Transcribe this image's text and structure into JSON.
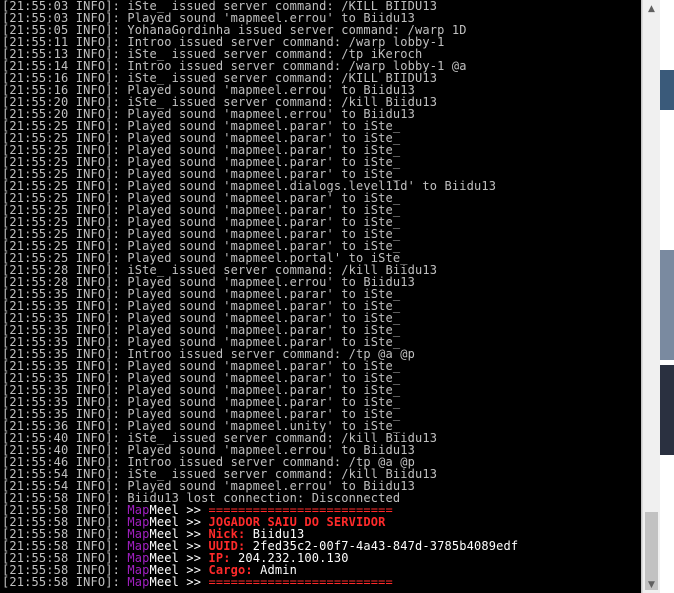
{
  "colors": {
    "text": "#c0c0c0",
    "map": "#a020c0",
    "meel": "#ffffff",
    "prompt": "#ffffff",
    "separator": "#ff2a2a",
    "label": "#ff2a2a",
    "value": "#ffffff",
    "title": "#ff2a2a"
  },
  "scrollbar": {
    "up_icon": "triangle-up",
    "down_icon": "triangle-down"
  },
  "console": {
    "lines": [
      [
        {
          "t": "[21:55:03 INFO]: iSte_ issued server command: /KILL BIIDU13"
        }
      ],
      [
        {
          "t": "[21:55:03 INFO]: Played sound 'mapmeel.errou' to Biidu13"
        }
      ],
      [
        {
          "t": "[21:55:05 INFO]: YohanaGordinha issued server command: /warp 1D"
        }
      ],
      [
        {
          "t": "[21:55:11 INFO]: Introo issued server command: /warp lobby-1"
        }
      ],
      [
        {
          "t": "[21:55:13 INFO]: iSte_ issued server command: /tp iKeroch"
        }
      ],
      [
        {
          "t": "[21:55:14 INFO]: Introo issued server command: /warp lobby-1 @a"
        }
      ],
      [
        {
          "t": "[21:55:16 INFO]: iSte_ issued server command: /KILL BIIDU13"
        }
      ],
      [
        {
          "t": "[21:55:16 INFO]: Played sound 'mapmeel.errou' to Biidu13"
        }
      ],
      [
        {
          "t": "[21:55:20 INFO]: iSte_ issued server command: /kill Biidu13"
        }
      ],
      [
        {
          "t": "[21:55:20 INFO]: Played sound 'mapmeel.errou' to Biidu13"
        }
      ],
      [
        {
          "t": "[21:55:25 INFO]: Played sound 'mapmeel.parar' to iSte_"
        }
      ],
      [
        {
          "t": "[21:55:25 INFO]: Played sound 'mapmeel.parar' to iSte_"
        }
      ],
      [
        {
          "t": "[21:55:25 INFO]: Played sound 'mapmeel.parar' to iSte_"
        }
      ],
      [
        {
          "t": "[21:55:25 INFO]: Played sound 'mapmeel.parar' to iSte_"
        }
      ],
      [
        {
          "t": "[21:55:25 INFO]: Played sound 'mapmeel.parar' to iSte_"
        }
      ],
      [
        {
          "t": "[21:55:25 INFO]: Played sound 'mapmeel.dialogs.level11d' to Biidu13"
        }
      ],
      [
        {
          "t": "[21:55:25 INFO]: Played sound 'mapmeel.parar' to iSte_"
        }
      ],
      [
        {
          "t": "[21:55:25 INFO]: Played sound 'mapmeel.parar' to iSte_"
        }
      ],
      [
        {
          "t": "[21:55:25 INFO]: Played sound 'mapmeel.parar' to iSte_"
        }
      ],
      [
        {
          "t": "[21:55:25 INFO]: Played sound 'mapmeel.parar' to iSte_"
        }
      ],
      [
        {
          "t": "[21:55:25 INFO]: Played sound 'mapmeel.parar' to iSte_"
        }
      ],
      [
        {
          "t": "[21:55:25 INFO]: Played sound 'mapmeel.portal' to iSte_"
        }
      ],
      [
        {
          "t": "[21:55:28 INFO]: iSte_ issued server command: /kill Biidu13"
        }
      ],
      [
        {
          "t": "[21:55:28 INFO]: Played sound 'mapmeel.errou' to Biidu13"
        }
      ],
      [
        {
          "t": "[21:55:35 INFO]: Played sound 'mapmeel.parar' to iSte_"
        }
      ],
      [
        {
          "t": "[21:55:35 INFO]: Played sound 'mapmeel.parar' to iSte_"
        }
      ],
      [
        {
          "t": "[21:55:35 INFO]: Played sound 'mapmeel.parar' to iSte_"
        }
      ],
      [
        {
          "t": "[21:55:35 INFO]: Played sound 'mapmeel.parar' to iSte_"
        }
      ],
      [
        {
          "t": "[21:55:35 INFO]: Played sound 'mapmeel.parar' to iSte_"
        }
      ],
      [
        {
          "t": "[21:55:35 INFO]: Introo issued server command: /tp @a @p"
        }
      ],
      [
        {
          "t": "[21:55:35 INFO]: Played sound 'mapmeel.parar' to iSte_"
        }
      ],
      [
        {
          "t": "[21:55:35 INFO]: Played sound 'mapmeel.parar' to iSte_"
        }
      ],
      [
        {
          "t": "[21:55:35 INFO]: Played sound 'mapmeel.parar' to iSte_"
        }
      ],
      [
        {
          "t": "[21:55:35 INFO]: Played sound 'mapmeel.parar' to iSte_"
        }
      ],
      [
        {
          "t": "[21:55:35 INFO]: Played sound 'mapmeel.parar' to iSte_"
        }
      ],
      [
        {
          "t": "[21:55:36 INFO]: Played sound 'mapmeel.unity' to iSte_"
        }
      ],
      [
        {
          "t": "[21:55:40 INFO]: iSte_ issued server command: /kill Biidu13"
        }
      ],
      [
        {
          "t": "[21:55:40 INFO]: Played sound 'mapmeel.errou' to Biidu13"
        }
      ],
      [
        {
          "t": "[21:55:46 INFO]: Introo issued server command: /tp @a @p"
        }
      ],
      [
        {
          "t": "[21:55:54 INFO]: iSte_ issued server command: /kill Biidu13"
        }
      ],
      [
        {
          "t": "[21:55:54 INFO]: Played sound 'mapmeel.errou' to Biidu13"
        }
      ],
      [
        {
          "t": "[21:55:58 INFO]: Biidu13 lost connection: Disconnected"
        }
      ],
      [
        {
          "t": "[21:55:58 INFO]: "
        },
        {
          "t": "Map",
          "c": "map"
        },
        {
          "t": "Meel",
          "c": "meel"
        },
        {
          "t": " >> ",
          "c": "prompt"
        },
        {
          "t": "=========================",
          "c": "separator"
        }
      ],
      [
        {
          "t": "[21:55:58 INFO]: "
        },
        {
          "t": "Map",
          "c": "map"
        },
        {
          "t": "Meel",
          "c": "meel"
        },
        {
          "t": " >> ",
          "c": "prompt"
        },
        {
          "t": "JOGADOR SAIU DO SERVIDOR",
          "c": "title"
        }
      ],
      [
        {
          "t": "[21:55:58 INFO]: "
        },
        {
          "t": "Map",
          "c": "map"
        },
        {
          "t": "Meel",
          "c": "meel"
        },
        {
          "t": " >> ",
          "c": "prompt"
        },
        {
          "t": "Nick: ",
          "c": "label"
        },
        {
          "t": "Biidu13",
          "c": "value"
        }
      ],
      [
        {
          "t": "[21:55:58 INFO]: "
        },
        {
          "t": "Map",
          "c": "map"
        },
        {
          "t": "Meel",
          "c": "meel"
        },
        {
          "t": " >> ",
          "c": "prompt"
        },
        {
          "t": "UUID: ",
          "c": "label"
        },
        {
          "t": "2fed35c2-00f7-4a43-847d-3785b4089edf",
          "c": "value"
        }
      ],
      [
        {
          "t": "[21:55:58 INFO]: "
        },
        {
          "t": "Map",
          "c": "map"
        },
        {
          "t": "Meel",
          "c": "meel"
        },
        {
          "t": " >> ",
          "c": "prompt"
        },
        {
          "t": "IP: ",
          "c": "label"
        },
        {
          "t": "204.232.100.130",
          "c": "value"
        }
      ],
      [
        {
          "t": "[21:55:58 INFO]: "
        },
        {
          "t": "Map",
          "c": "map"
        },
        {
          "t": "Meel",
          "c": "meel"
        },
        {
          "t": " >> ",
          "c": "prompt"
        },
        {
          "t": "Cargo: ",
          "c": "label"
        },
        {
          "t": "Admin",
          "c": "value"
        }
      ],
      [
        {
          "t": "[21:55:58 INFO]: "
        },
        {
          "t": "Map",
          "c": "map"
        },
        {
          "t": "Meel",
          "c": "meel"
        },
        {
          "t": " >> ",
          "c": "prompt"
        },
        {
          "t": "=========================",
          "c": "separator"
        }
      ]
    ]
  }
}
